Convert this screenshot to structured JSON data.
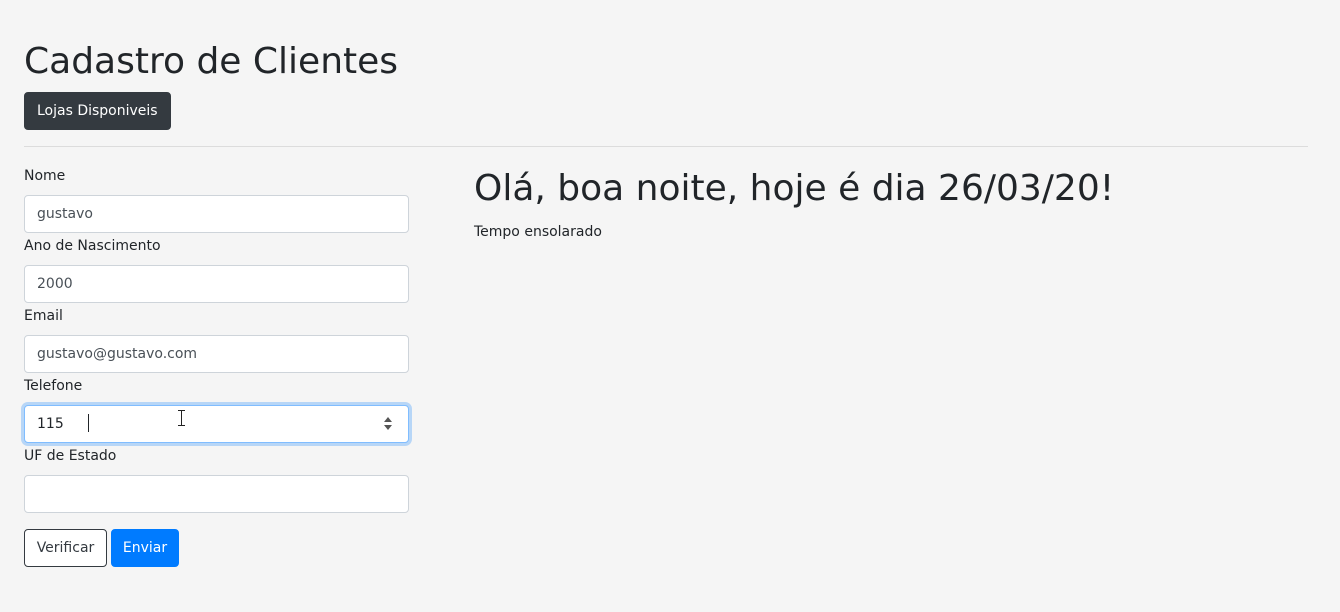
{
  "header": {
    "title": "Cadastro de Clientes",
    "stores_button_label": "Lojas Disponiveis"
  },
  "form": {
    "fields": [
      {
        "label": "Nome",
        "value": "gustavo",
        "placeholder": ""
      },
      {
        "label": "Ano de Nascimento",
        "value": "2000",
        "placeholder": ""
      },
      {
        "label": "Email",
        "value": "gustavo@gustavo.com",
        "placeholder": ""
      },
      {
        "label": "Telefone",
        "value": "115",
        "placeholder": ""
      },
      {
        "label": "UF de Estado",
        "value": "",
        "placeholder": ""
      }
    ],
    "verify_button_label": "Verificar",
    "submit_button_label": "Enviar"
  },
  "info": {
    "greeting": "Olá, boa noite, hoje é dia 26/03/20!",
    "weather": "Tempo ensolarado"
  },
  "colors": {
    "primary": "#007bff",
    "dark": "#343a40",
    "focus_border": "#80bdff"
  }
}
